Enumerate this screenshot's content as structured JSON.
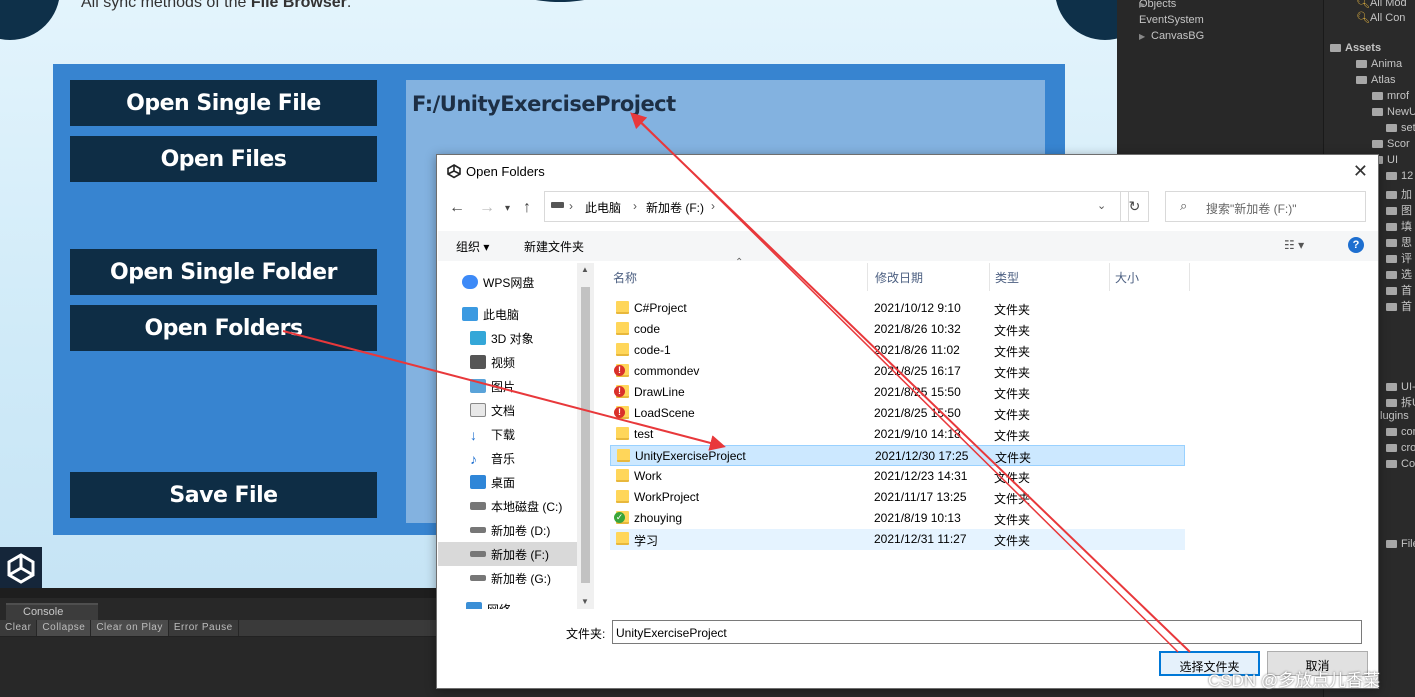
{
  "game": {
    "sync_text_prefix": "All sync methods of the ",
    "sync_text_bold": "File Browser",
    "sync_text_suffix": ".",
    "buttons": {
      "open_single_file": "Open Single File",
      "open_files": "Open Files",
      "open_single_folder": "Open Single Folder",
      "open_folders": "Open Folders",
      "save_file": "Save File"
    },
    "path": "F:/UnityExerciseProject"
  },
  "console": {
    "tab": "Console",
    "toolbar": [
      "Clear",
      "Collapse",
      "Clear on Play",
      "Error Pause"
    ]
  },
  "hierarchy": {
    "items": [
      "Objects",
      "EventSystem",
      "CanvasBG"
    ]
  },
  "project": {
    "items": [
      "All Mod",
      "All Con",
      "Assets",
      "Anima",
      "Atlas",
      "mrof",
      "NewU",
      "set",
      "Scor",
      "UI",
      "12",
      "加",
      "图",
      "填",
      "思",
      "评",
      "选",
      "首",
      "首",
      "UI-人",
      "拆UI",
      "lugins",
      "comr",
      "cross",
      "Co",
      "File"
    ]
  },
  "dialog": {
    "title": "Open Folders",
    "close": "✕",
    "address": [
      "此电脑",
      "新加卷 (F:)"
    ],
    "search_placeholder": "搜索\"新加卷 (F:)\"",
    "organize": "组织 ▾",
    "new_folder": "新建文件夹",
    "help": "?",
    "nav": [
      {
        "label": "WPS网盘",
        "icon": "cloud-icon"
      },
      {
        "label": "此电脑",
        "icon": "computer-icon"
      },
      {
        "label": "3D 对象",
        "icon": "3d-objects-icon"
      },
      {
        "label": "视频",
        "icon": "video-icon"
      },
      {
        "label": "图片",
        "icon": "pictures-icon"
      },
      {
        "label": "文档",
        "icon": "documents-icon"
      },
      {
        "label": "下载",
        "icon": "download-icon"
      },
      {
        "label": "音乐",
        "icon": "music-icon"
      },
      {
        "label": "桌面",
        "icon": "desktop-icon"
      },
      {
        "label": "本地磁盘 (C:)",
        "icon": "drive-icon"
      },
      {
        "label": "新加卷 (D:)",
        "icon": "drive-icon"
      },
      {
        "label": "新加卷 (F:)",
        "icon": "drive-icon"
      },
      {
        "label": "新加卷 (G:)",
        "icon": "drive-icon"
      },
      {
        "label": "网络",
        "icon": "network-icon"
      }
    ],
    "columns": [
      "名称",
      "修改日期",
      "类型",
      "大小"
    ],
    "files": [
      {
        "name": "C#Project",
        "date": "2021/10/12 9:10",
        "type": "文件夹",
        "badge": ""
      },
      {
        "name": "code",
        "date": "2021/8/26 10:32",
        "type": "文件夹",
        "badge": ""
      },
      {
        "name": "code-1",
        "date": "2021/8/26 11:02",
        "type": "文件夹",
        "badge": ""
      },
      {
        "name": "commondev",
        "date": "2021/8/25 16:17",
        "type": "文件夹",
        "badge": "error"
      },
      {
        "name": "DrawLine",
        "date": "2021/8/25 15:50",
        "type": "文件夹",
        "badge": "error"
      },
      {
        "name": "LoadScene",
        "date": "2021/8/25 15:50",
        "type": "文件夹",
        "badge": "error"
      },
      {
        "name": "test",
        "date": "2021/9/10 14:18",
        "type": "文件夹",
        "badge": ""
      },
      {
        "name": "UnityExerciseProject",
        "date": "2021/12/30 17:25",
        "type": "文件夹",
        "badge": ""
      },
      {
        "name": "Work",
        "date": "2021/12/23 14:31",
        "type": "文件夹",
        "badge": ""
      },
      {
        "name": "WorkProject",
        "date": "2021/11/17 13:25",
        "type": "文件夹",
        "badge": ""
      },
      {
        "name": "zhouying",
        "date": "2021/8/19 10:13",
        "type": "文件夹",
        "badge": "ok"
      },
      {
        "name": "学习",
        "date": "2021/12/31 11:27",
        "type": "文件夹",
        "badge": ""
      }
    ],
    "selected_file": "UnityExerciseProject",
    "hovered_file": "学习",
    "folder_label": "文件夹:",
    "folder_value": "UnityExerciseProject",
    "select_button": "选择文件夹",
    "cancel_button": "取消"
  },
  "watermark": "CSDN @多放点儿香菜",
  "colors": {
    "panel_blue": "#3784d0",
    "button_navy": "#0e2d45",
    "selection": "#cce8ff",
    "arrow_red": "#e8383b"
  }
}
